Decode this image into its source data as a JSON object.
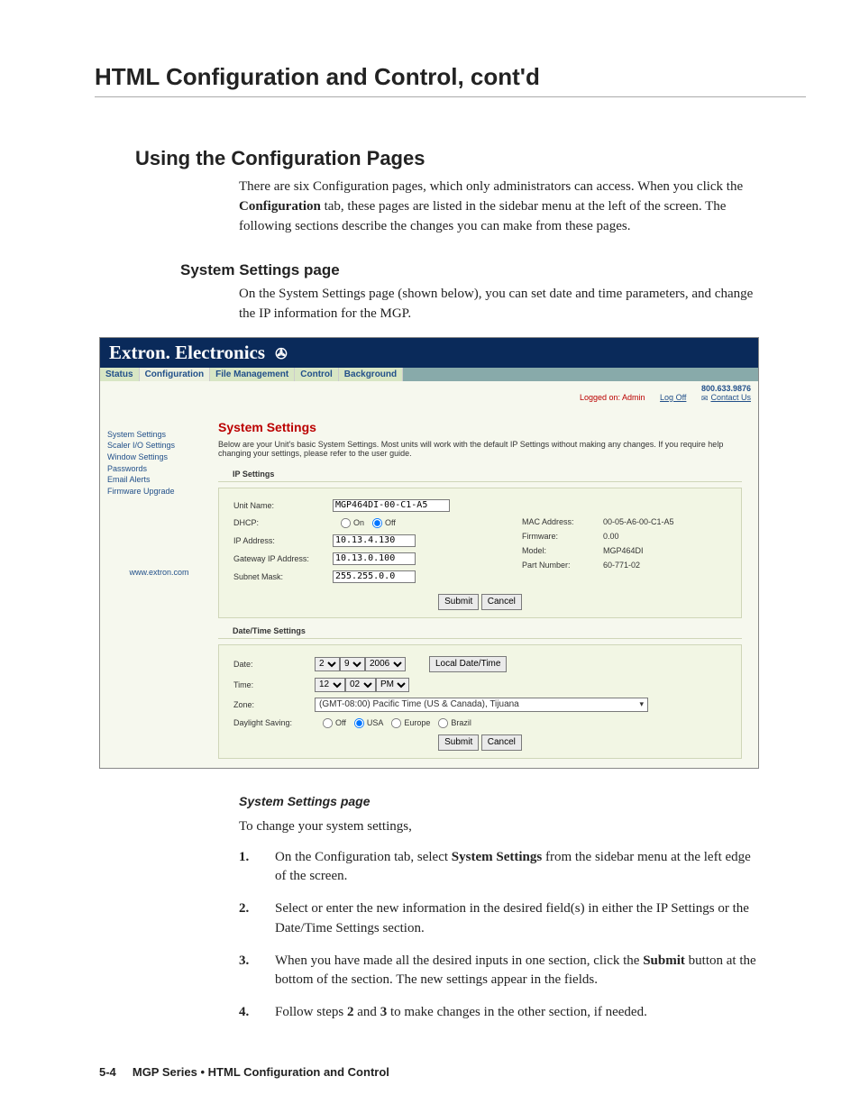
{
  "doc": {
    "h1": "HTML Configuration and Control, cont'd",
    "h2": "Using the Configuration Pages",
    "intro_a": "There are six Configuration pages, which only administrators can access.  When you click the ",
    "intro_bold": "Configuration",
    "intro_b": " tab, these pages are listed in the sidebar menu at the left of the screen.  The following sections describe the changes you can make from these pages.",
    "h3": "System Settings page",
    "p3": "On the System Settings page (shown below), you can set date and time parameters, and change the IP information for the MGP.",
    "h4": "System Settings page",
    "p4": "To change your system settings,",
    "steps": [
      {
        "n": "1.",
        "a": "On the Configuration tab, select ",
        "bold": "System Settings",
        "b": " from the sidebar menu at the left edge of the screen."
      },
      {
        "n": "2.",
        "a": "Select or enter the new information in the desired field(s) in either the IP Settings or the Date/Time Settings section.",
        "bold": "",
        "b": ""
      },
      {
        "n": "3.",
        "a": "When you have made all the desired inputs in one section, click the ",
        "bold": "Submit",
        "b": " button at the bottom of the section.  The new settings appear in the fields."
      },
      {
        "n": "4.",
        "a": "Follow steps ",
        "bold": "2",
        "mid": " and ",
        "bold2": "3",
        "b": " to make changes in the other section, if needed."
      }
    ],
    "footer_page": "5-4",
    "footer_text": "MGP Series • HTML Configuration and Control"
  },
  "shot": {
    "brand": "Extron. Electronics",
    "tabs": [
      "Status",
      "Configuration",
      "File Management",
      "Control",
      "Background"
    ],
    "phone": "800.633.9876",
    "logged": "Logged on: Admin",
    "logoff": "Log Off",
    "contact": "Contact Us",
    "side": [
      "System Settings",
      "Scaler I/O Settings",
      "Window Settings",
      "Passwords",
      "Email Alerts",
      "Firmware Upgrade"
    ],
    "url": "www.extron.com",
    "title": "System Settings",
    "desc": "Below are your Unit's basic System Settings. Most units will work with the default IP Settings without making any changes. If you require help changing your settings, please refer to the user guide.",
    "ip": {
      "hd": "IP Settings",
      "unit_label": "Unit Name:",
      "unit": "MGP464DI-00-C1-A5",
      "dhcp_label": "DHCP:",
      "on": "On",
      "off": "Off",
      "ip_label": "IP Address:",
      "ip": "10.13.4.130",
      "gw_label": "Gateway IP Address:",
      "gw": "10.13.0.100",
      "sm_label": "Subnet Mask:",
      "sm": "255.255.0.0",
      "mac_label": "MAC Address:",
      "mac": "00-05-A6-00-C1-A5",
      "fw_label": "Firmware:",
      "fw": "0.00",
      "mdl_label": "Model:",
      "mdl": "MGP464DI",
      "pn_label": "Part Number:",
      "pn": "60-771-02",
      "submit": "Submit",
      "cancel": "Cancel"
    },
    "dt": {
      "hd": "Date/Time Settings",
      "date_label": "Date:",
      "month": "2",
      "day": "9",
      "year": "2006",
      "local": "Local Date/Time",
      "time_label": "Time:",
      "hr": "12",
      "min": "02",
      "mer": "PM",
      "zone_label": "Zone:",
      "zone": "(GMT-08:00) Pacific Time (US & Canada), Tijuana",
      "dst_label": "Daylight Saving:",
      "off": "Off",
      "usa": "USA",
      "eur": "Europe",
      "bra": "Brazil",
      "submit": "Submit",
      "cancel": "Cancel"
    }
  }
}
